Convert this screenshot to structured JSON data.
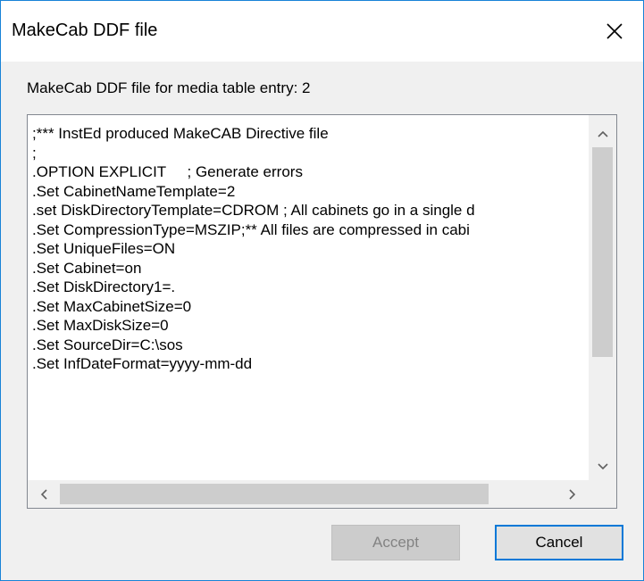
{
  "window": {
    "title": "MakeCab DDF file"
  },
  "prompt_label": "MakeCab DDF file for media table entry: 2",
  "textbox": {
    "lines": [
      ";*** InstEd produced MakeCAB Directive file",
      ";",
      ".OPTION EXPLICIT     ; Generate errors",
      ".Set CabinetNameTemplate=2",
      ".set DiskDirectoryTemplate=CDROM ; All cabinets go in a single d",
      ".Set CompressionType=MSZIP;** All files are compressed in cabi",
      ".Set UniqueFiles=ON",
      ".Set Cabinet=on",
      ".Set DiskDirectory1=.",
      ".Set MaxCabinetSize=0",
      ".Set MaxDiskSize=0",
      ".Set SourceDir=C:\\sos",
      ".Set InfDateFormat=yyyy-mm-dd"
    ]
  },
  "buttons": {
    "accept": "Accept",
    "cancel": "Cancel"
  },
  "icons": {
    "close": "close-icon",
    "scroll_up": "chevron-up-icon",
    "scroll_down": "chevron-down-icon",
    "scroll_left": "chevron-left-icon",
    "scroll_right": "chevron-right-icon"
  },
  "colors": {
    "window_border": "#1883d7",
    "dialog_bg": "#f0f0f0",
    "focus_border": "#0078d7",
    "scroll_thumb": "#cdcdcd"
  }
}
